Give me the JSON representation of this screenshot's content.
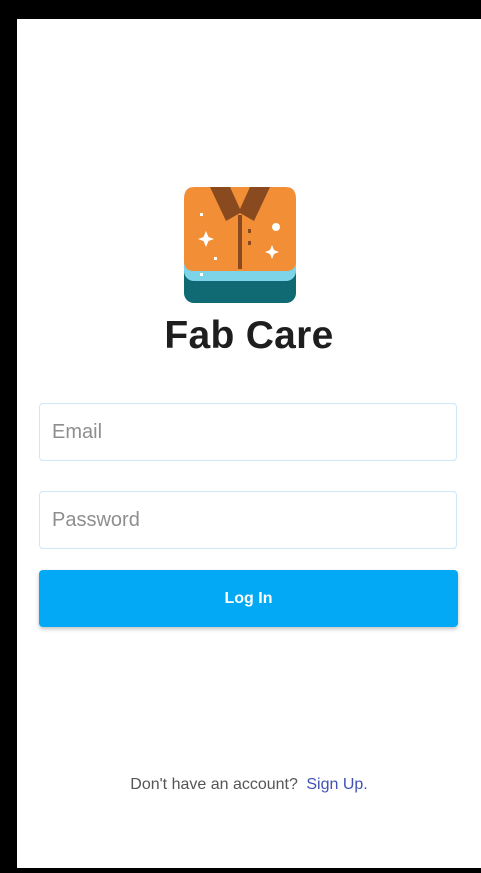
{
  "app": {
    "name": "Fab Care",
    "logo_icon": "folded-shirt-icon"
  },
  "login_form": {
    "email_placeholder": "Email",
    "email_value": "",
    "password_placeholder": "Password",
    "password_value": "",
    "submit_label": "Log In"
  },
  "footer": {
    "prompt": "Don't have an account?",
    "signup_label": "Sign Up."
  },
  "colors": {
    "primary": "#03a9f4",
    "link": "#3f51b5",
    "logo_orange": "#f28e36",
    "logo_teal_dark": "#0f6a73",
    "logo_teal_light": "#7dd3e8",
    "logo_collar": "#8a4a1f"
  }
}
